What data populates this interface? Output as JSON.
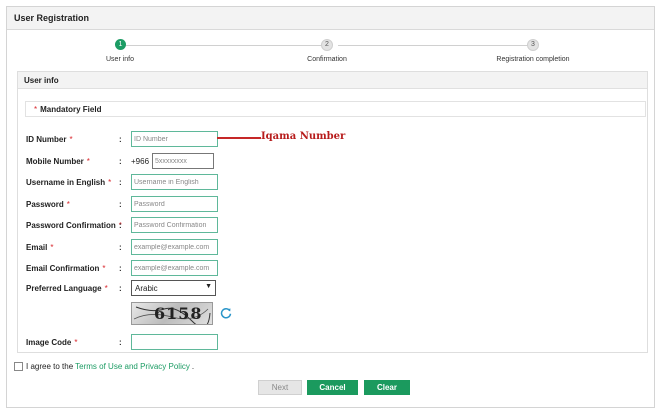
{
  "header": {
    "title": "User Registration"
  },
  "stepper": {
    "steps": [
      {
        "number": "1",
        "label": "User info",
        "active": true
      },
      {
        "number": "2",
        "label": "Confirmation",
        "active": false
      },
      {
        "number": "3",
        "label": "Registration completion",
        "active": false
      }
    ]
  },
  "panel": {
    "title": "User info",
    "mandatory_star": "*",
    "mandatory_text": "Mandatory Field"
  },
  "form": {
    "colon": ":",
    "required_mark": "*",
    "fields": [
      {
        "label": "ID Number",
        "placeholder": "ID Number"
      },
      {
        "label": "Mobile Number",
        "prefix": "+966",
        "placeholder": "5xxxxxxxx"
      },
      {
        "label": "Username in English",
        "placeholder": "Username in English"
      },
      {
        "label": "Password",
        "placeholder": "Password"
      },
      {
        "label": "Password Confirmation",
        "placeholder": "Password Confirmation"
      },
      {
        "label": "Email",
        "placeholder": "example@example.com"
      },
      {
        "label": "Email Confirmation",
        "placeholder": "example@example.com"
      },
      {
        "label": "Preferred Language",
        "value": "Arabic"
      },
      {
        "label": "Image Code",
        "placeholder": ""
      }
    ],
    "captcha_text": "6158"
  },
  "annotation": {
    "text": "Iqama Number",
    "color": "#b71c1c"
  },
  "agreement": {
    "prefix": "I agree to the",
    "link": "Terms of Use and Privacy Policy",
    "suffix": "."
  },
  "buttons": {
    "next": "Next",
    "cancel": "Cancel",
    "clear": "Clear"
  },
  "colors": {
    "accent": "#1b9a5e",
    "required": "#d9262c",
    "input_border": "#5fb89a"
  }
}
